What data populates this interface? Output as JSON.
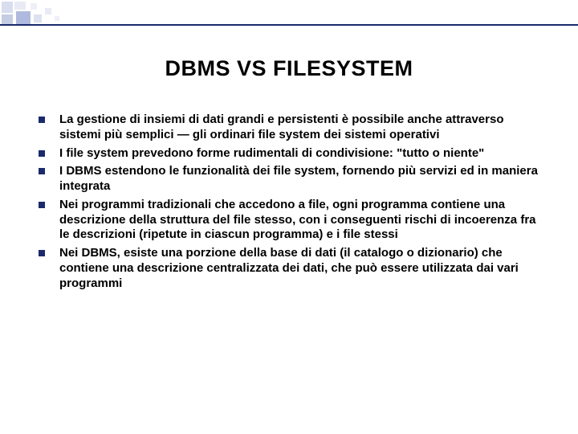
{
  "title": "DBMS VS FILESYSTEM",
  "bullets": [
    "La gestione di insiemi di dati grandi e persistenti è possibile anche attraverso sistemi più semplici — gli ordinari file system dei sistemi operativi",
    "I file system prevedono forme rudimentali di condivisione: \"tutto o niente\"",
    "I DBMS estendono le funzionalità dei file system, fornendo più servizi ed in maniera integrata",
    "Nei programmi tradizionali che accedono a file, ogni programma contiene una descrizione della struttura del file stesso, con i conseguenti rischi di incoerenza fra le descrizioni (ripetute in ciascun programma) e i file stessi",
    "Nei DBMS, esiste una porzione della base di dati (il catalogo o dizionario) che contiene una descrizione centralizzata dei dati, che può essere utilizzata dai vari programmi"
  ],
  "colors": {
    "accent": "#1a2a6c",
    "decoLight": "#c5cde4"
  }
}
